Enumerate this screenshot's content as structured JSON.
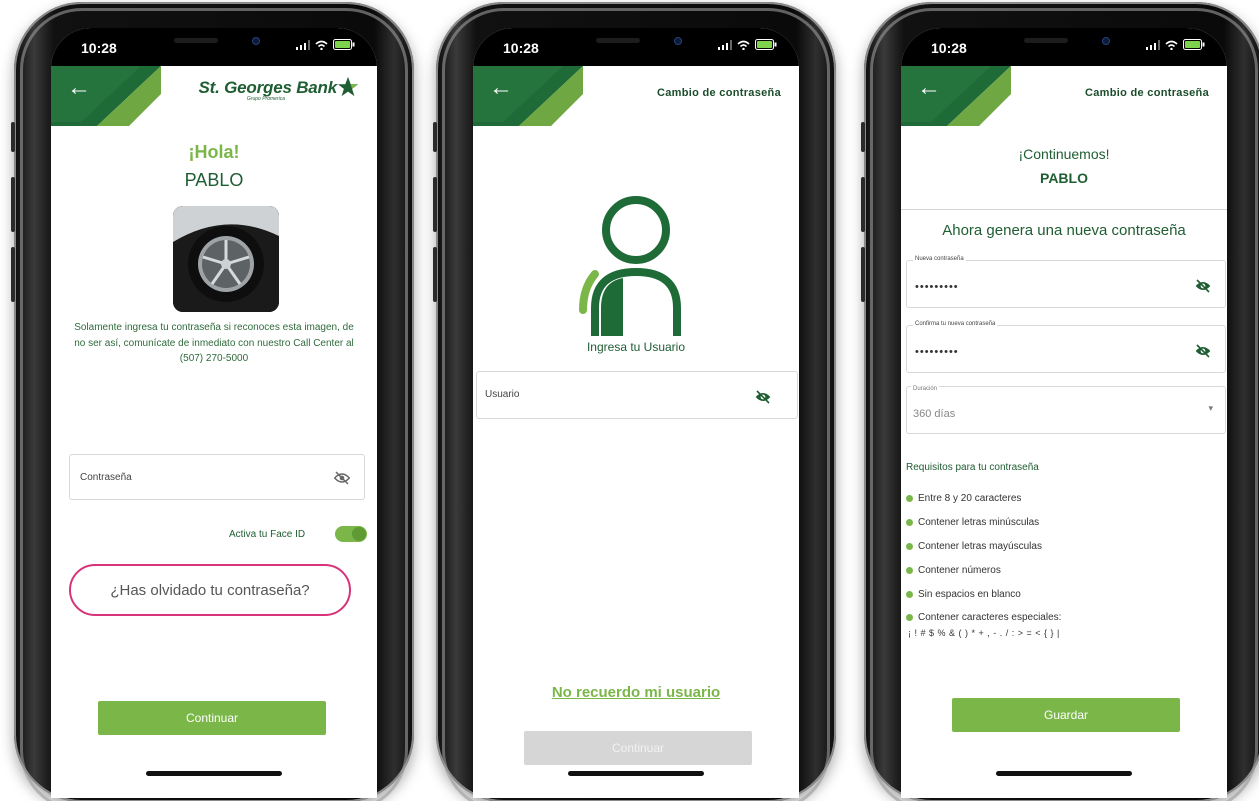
{
  "status": {
    "time": "10:28"
  },
  "colors": {
    "brand_green": "#1f6b37",
    "accent_green": "#7ab648",
    "disabled": "#d6d6d6"
  },
  "screen1": {
    "brand": "St. Georges Bank",
    "brand_sub": "Grupo Promerica",
    "greeting": "¡Hola!",
    "user_name": "PABLO",
    "security_message": "Solamente ingresa tu contraseña si reconoces esta imagen, de no ser así, comunícate de inmediato con nuestro Call Center al (507) 270-5000",
    "password_label": "Contraseña",
    "face_id_label": "Activa tu Face ID",
    "face_id_enabled": true,
    "forgot_password": "¿Has olvidado tu contraseña?",
    "continue": "Continuar"
  },
  "screen2": {
    "title": "Cambio de contraseña",
    "prompt": "Ingresa tu Usuario",
    "username_label": "Usuario",
    "forgot_user": "No recuerdo mi usuario",
    "continue": "Continuar"
  },
  "screen3": {
    "title": "Cambio de contraseña",
    "greeting": "¡Continuemos!",
    "user_name": "PABLO",
    "instruction": "Ahora genera una nueva contraseña",
    "new_password_label": "Nueva contraseña",
    "new_password_value": "•••••••••",
    "confirm_label": "Confirma tu nueva contraseña",
    "confirm_value": "•••••••••",
    "duration_label": "Duración",
    "duration_value": "360 días",
    "requirements_title": "Requisitos para tu contraseña",
    "requirements": [
      "Entre 8 y 20 caracteres",
      "Contener letras minúsculas",
      "Contener letras mayúsculas",
      "Contener números",
      "Sin espacios en blanco",
      "Contener caracteres especiales:"
    ],
    "special_chars": "¡ ! # $ % & ( ) * + , - . / : > = < { } |",
    "save": "Guardar"
  }
}
